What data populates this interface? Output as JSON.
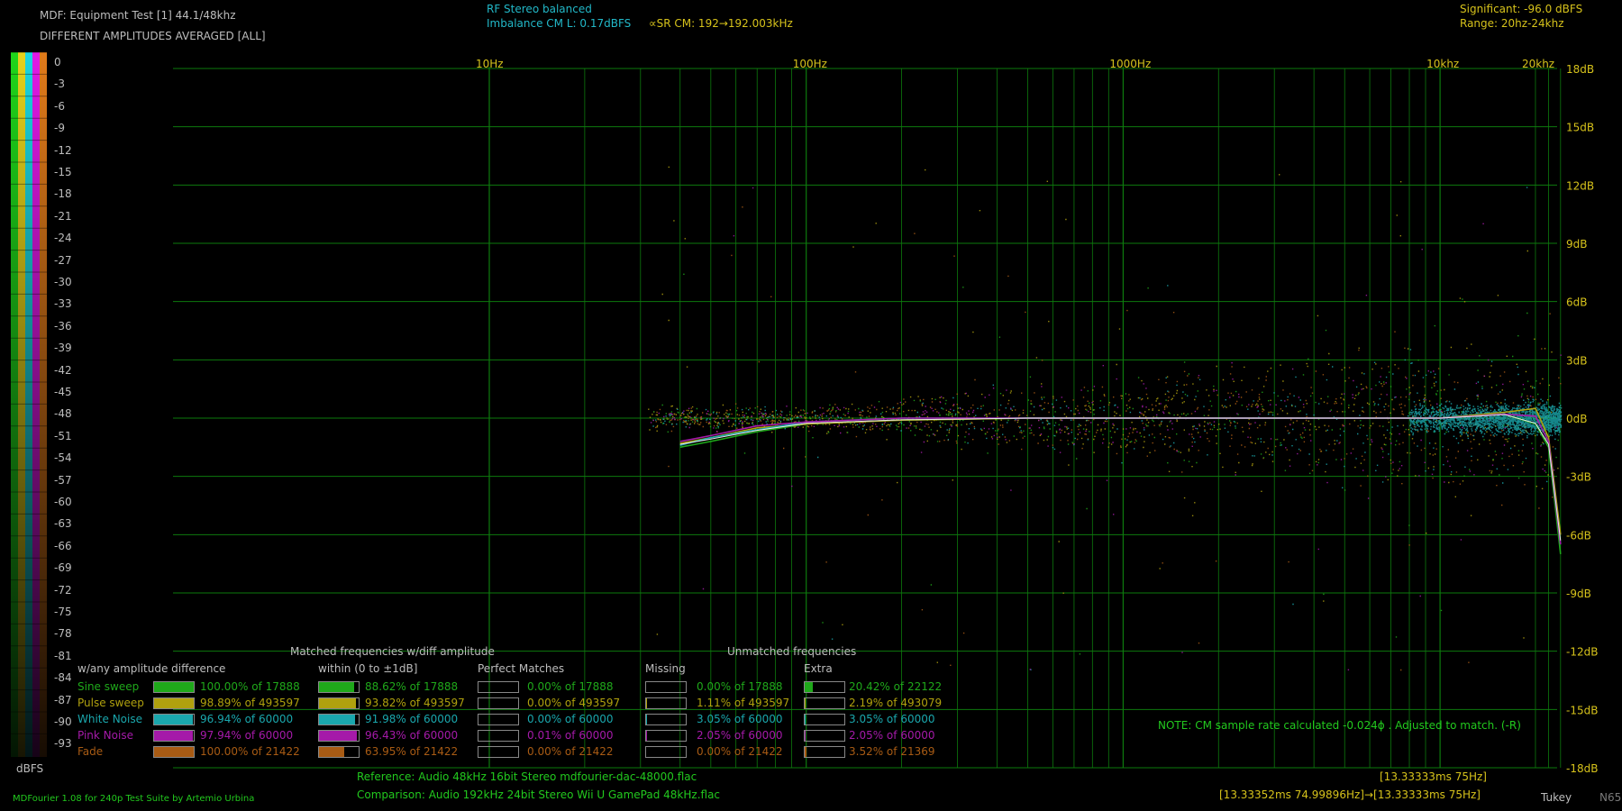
{
  "header": {
    "title": "MDF: Equipment Test [1] 44.1/48khz",
    "subtitle": "DIFFERENT AMPLITUDES AVERAGED [ALL]",
    "mode": "RF Stereo balanced",
    "imbalance": "Imbalance CM L: 0.17dBFS",
    "sr": "∝SR CM: 192→192.003kHz",
    "significant": "Significant: -96.0 dBFS",
    "range": "Range: 20hz-24khz"
  },
  "dbfs_scale": {
    "unit": "dBFS",
    "ticks": [
      "0",
      "-3",
      "-6",
      "-9",
      "-12",
      "-15",
      "-18",
      "-21",
      "-24",
      "-27",
      "-30",
      "-33",
      "-36",
      "-39",
      "-42",
      "-45",
      "-48",
      "-51",
      "-54",
      "-57",
      "-60",
      "-63",
      "-66",
      "-69",
      "-72",
      "-75",
      "-78",
      "-81",
      "-84",
      "-87",
      "-90",
      "-93"
    ]
  },
  "colors": {
    "sine": "#1fa81a",
    "pulse": "#b0a10e",
    "white": "#1aa7ad",
    "pink": "#a51aa9",
    "fade": "#a85b14",
    "grid": "#0d7a0d",
    "axis_text": "#d6c21b"
  },
  "chart_data": {
    "type": "scatter",
    "x_scale": "log",
    "x_ticks": [
      "10Hz",
      "100Hz",
      "1000Hz",
      "10khz",
      "20khz"
    ],
    "x_tick_values": [
      10,
      100,
      1000,
      10000,
      20000
    ],
    "y_ticks": [
      "18dB",
      "15dB",
      "12dB",
      "9dB",
      "6dB",
      "3dB",
      "0dB",
      "-3dB",
      "-6dB",
      "-9dB",
      "-12dB",
      "-15dB",
      "-18dB"
    ],
    "y_tick_values": [
      18,
      15,
      12,
      9,
      6,
      3,
      0,
      -3,
      -6,
      -9,
      -12,
      -15,
      -18
    ],
    "ylim": [
      -18,
      18
    ],
    "series": [
      {
        "key": "sine",
        "points": [
          [
            40,
            -1.5
          ],
          [
            50,
            -1.2
          ],
          [
            70,
            -0.7
          ],
          [
            100,
            -0.3
          ],
          [
            200,
            -0.1
          ],
          [
            500,
            0
          ],
          [
            1000,
            0
          ],
          [
            5000,
            0
          ],
          [
            10000,
            0
          ],
          [
            16000,
            0.2
          ],
          [
            20000,
            -0.3
          ],
          [
            22000,
            -1.5
          ],
          [
            24000,
            -7
          ]
        ]
      },
      {
        "key": "pulse",
        "points": [
          [
            40,
            -1.3
          ],
          [
            50,
            -1.0
          ],
          [
            70,
            -0.5
          ],
          [
            100,
            -0.3
          ],
          [
            200,
            -0.1
          ],
          [
            500,
            0
          ],
          [
            1000,
            0
          ],
          [
            5000,
            0
          ],
          [
            10000,
            0
          ],
          [
            16000,
            0.3
          ],
          [
            20000,
            0.5
          ],
          [
            22000,
            -1.0
          ],
          [
            24000,
            -6
          ]
        ]
      },
      {
        "key": "white",
        "points": [
          [
            40,
            -1.4
          ],
          [
            50,
            -1.0
          ],
          [
            70,
            -0.6
          ],
          [
            100,
            -0.2
          ],
          [
            200,
            0
          ],
          [
            500,
            0
          ],
          [
            1000,
            0
          ],
          [
            5000,
            0
          ],
          [
            10000,
            0
          ],
          [
            16000,
            0.2
          ],
          [
            20000,
            0.1
          ],
          [
            22000,
            -1.2
          ],
          [
            24000,
            -6.5
          ]
        ]
      },
      {
        "key": "pink",
        "points": [
          [
            40,
            -1.2
          ],
          [
            50,
            -0.9
          ],
          [
            70,
            -0.4
          ],
          [
            100,
            -0.2
          ],
          [
            200,
            0
          ],
          [
            500,
            0
          ],
          [
            1000,
            0
          ],
          [
            5000,
            0
          ],
          [
            10000,
            0
          ],
          [
            16000,
            0.2
          ],
          [
            20000,
            0.1
          ],
          [
            22000,
            -1.2
          ],
          [
            24000,
            -6.5
          ]
        ]
      }
    ]
  },
  "stats": {
    "section_matched": "Matched frequencies w/diff amplitude",
    "section_unmatched": "Unmatched frequencies",
    "col_any": "w/any amplitude difference",
    "col_within": "within (0 to ±1dB]",
    "col_perfect": "Perfect Matches",
    "col_missing": "Missing",
    "col_extra": "Extra",
    "rows": [
      {
        "key": "sine",
        "label": "Sine sweep",
        "any": "100.00% of 17888",
        "any_f": 1.0,
        "within": "88.62% of 17888",
        "within_f": 0.886,
        "perfect": "0.00% of 17888",
        "perfect_f": 0,
        "missing": "0.00% of 17888",
        "missing_f": 0,
        "extra": "20.42% of 22122",
        "extra_f": 0.204
      },
      {
        "key": "pulse",
        "label": "Pulse sweep",
        "any": "98.89% of 493597",
        "any_f": 0.989,
        "within": "93.82% of 493597",
        "within_f": 0.938,
        "perfect": "0.00% of 493597",
        "perfect_f": 0,
        "missing": "1.11% of 493597",
        "missing_f": 0.011,
        "extra": "2.19% of 493079",
        "extra_f": 0.022
      },
      {
        "key": "white",
        "label": "White Noise",
        "any": "96.94% of 60000",
        "any_f": 0.969,
        "within": "91.98% of 60000",
        "within_f": 0.92,
        "perfect": "0.00% of 60000",
        "perfect_f": 0,
        "missing": "3.05% of 60000",
        "missing_f": 0.03,
        "extra": "3.05% of 60000",
        "extra_f": 0.03
      },
      {
        "key": "pink",
        "label": "Pink Noise",
        "any": "97.94% of 60000",
        "any_f": 0.979,
        "within": "96.43% of 60000",
        "within_f": 0.964,
        "perfect": "0.01% of 60000",
        "perfect_f": 0.0,
        "missing": "2.05% of 60000",
        "missing_f": 0.02,
        "extra": "2.05% of 60000",
        "extra_f": 0.02
      },
      {
        "key": "fade",
        "label": "Fade",
        "any": "100.00% of 21422",
        "any_f": 1.0,
        "within": "63.95% of 21422",
        "within_f": 0.64,
        "perfect": "0.00% of 21422",
        "perfect_f": 0,
        "missing": "0.00% of 21422",
        "missing_f": 0,
        "extra": "3.52% of 21369",
        "extra_f": 0.035
      }
    ]
  },
  "footer": {
    "note": "NOTE: CM sample rate calculated -0.024ϕ . Adjusted to match. (-R)",
    "reference": "Reference:   Audio    48kHz 16bit Stereo mdfourier-dac-48000.flac",
    "comparison": "Comparison: Audio  192kHz 24bit Stereo Wii U GamePad 48kHz.flac",
    "credit": "MDFourier 1.08 for 240p Test Suite by Artemio Urbina",
    "timing_ref": "[13.33333ms 75Hz]",
    "timing_cmp": "[13.33352ms 74.99896Hz]→[13.33333ms 75Hz]",
    "window": "Tukey",
    "tag": "N65"
  }
}
